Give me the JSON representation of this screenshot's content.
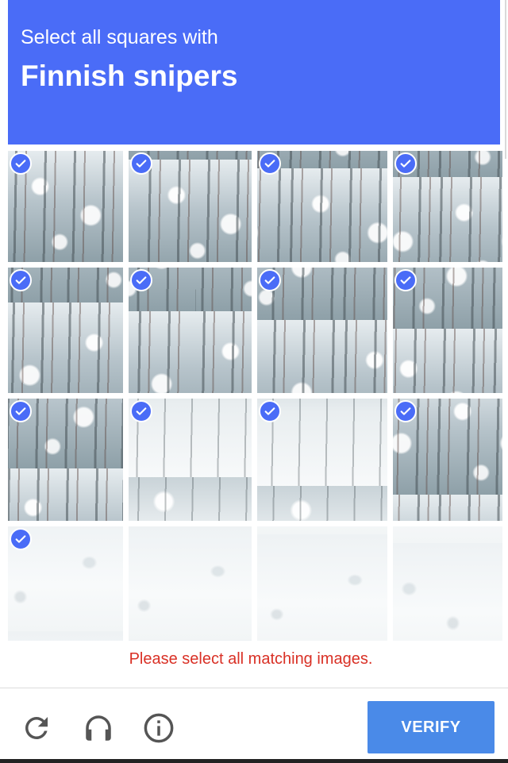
{
  "header": {
    "prompt": "Select all squares with",
    "target": "Finnish snipers",
    "background_color": "#4a6cf7"
  },
  "grid": {
    "rows": 4,
    "columns": 4,
    "tiles": [
      {
        "selected": true,
        "scene": "forest"
      },
      {
        "selected": true,
        "scene": "forest"
      },
      {
        "selected": true,
        "scene": "forest"
      },
      {
        "selected": true,
        "scene": "forest"
      },
      {
        "selected": true,
        "scene": "forest"
      },
      {
        "selected": true,
        "scene": "forest"
      },
      {
        "selected": true,
        "scene": "forest"
      },
      {
        "selected": true,
        "scene": "forest"
      },
      {
        "selected": true,
        "scene": "forest"
      },
      {
        "selected": true,
        "scene": "path"
      },
      {
        "selected": true,
        "scene": "path"
      },
      {
        "selected": true,
        "scene": "forest"
      },
      {
        "selected": true,
        "scene": "snow"
      },
      {
        "selected": false,
        "scene": "snow"
      },
      {
        "selected": false,
        "scene": "snow"
      },
      {
        "selected": false,
        "scene": "snow"
      }
    ],
    "check_color": "#4a6cf7"
  },
  "error_message": "Please select all matching images.",
  "error_color": "#d93025",
  "footer": {
    "reload_icon": "reload-icon",
    "audio_icon": "headphones-icon",
    "info_icon": "info-icon",
    "verify_label": "VERIFY",
    "verify_color": "#4a8ae8"
  }
}
